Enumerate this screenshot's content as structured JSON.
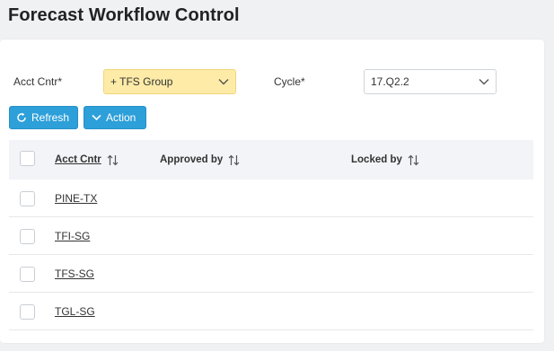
{
  "page": {
    "title": "Forecast Workflow Control"
  },
  "filters": {
    "acct_cntr": {
      "label": "Acct Cntr*",
      "value": "+ TFS Group"
    },
    "cycle": {
      "label": "Cycle*",
      "value": "17.Q2.2"
    }
  },
  "toolbar": {
    "refresh_label": "Refresh",
    "action_label": "Action"
  },
  "table": {
    "columns": [
      "Acct Cntr",
      "Approved by",
      "Locked by"
    ],
    "rows": [
      {
        "acct_cntr": "PINE-TX",
        "approved_by": "",
        "locked_by": ""
      },
      {
        "acct_cntr": "TFI-SG",
        "approved_by": "",
        "locked_by": ""
      },
      {
        "acct_cntr": "TFS-SG",
        "approved_by": "",
        "locked_by": ""
      },
      {
        "acct_cntr": "TGL-SG",
        "approved_by": "",
        "locked_by": ""
      }
    ]
  },
  "colors": {
    "accent": "#2d9fd9",
    "required_field_bg": "#fdeba7",
    "header_bg": "#f2f4f7"
  }
}
